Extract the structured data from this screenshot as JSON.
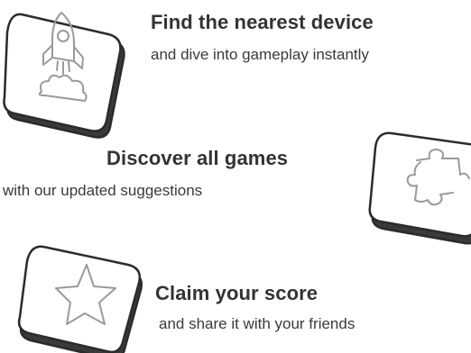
{
  "features": [
    {
      "icon": "rocket-icon",
      "title": "Find the nearest device",
      "subtitle": "and dive into gameplay instantly"
    },
    {
      "icon": "puzzle-icon",
      "title": "Discover all games",
      "subtitle": "with our updated suggestions"
    },
    {
      "icon": "star-icon",
      "title": "Claim your score",
      "subtitle": "and share it with your friends"
    }
  ],
  "colors": {
    "text": "#333333",
    "tile_fill": "#ffffff",
    "tile_outline": "#2b2b2b",
    "tile_base": "#3a3a3a",
    "icon_stroke": "#9a9a9a"
  }
}
